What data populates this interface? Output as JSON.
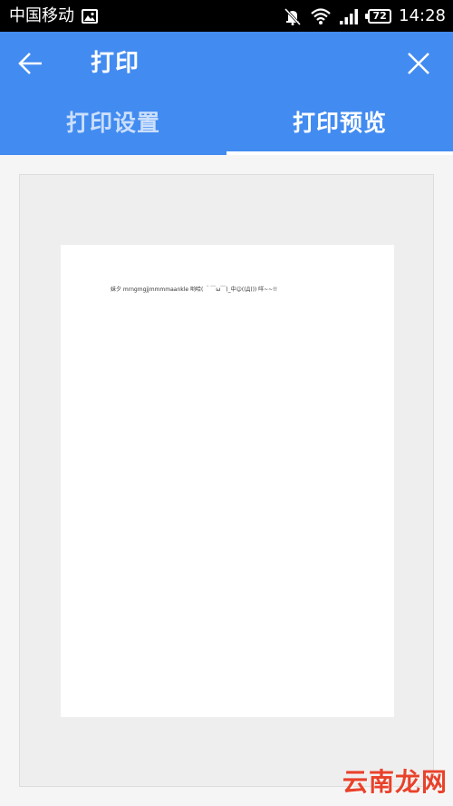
{
  "status_bar": {
    "carrier": "中国移动",
    "battery": "72",
    "time": "14:28"
  },
  "app_bar": {
    "title": "打印"
  },
  "tabs": [
    {
      "label": "打印设置",
      "active": false
    },
    {
      "label": "打印预览",
      "active": true
    }
  ],
  "preview": {
    "page_text": "妹夕 mrngmgjjmmmmaankle 哟哈( ＾￣ω￣)_中☺((Д))) 咩~~!!"
  },
  "watermark": "云南龙网",
  "colors": {
    "accent": "#428bf1",
    "status_bar": "#000000",
    "background": "#f5f5f5",
    "watermark": "#e8422b"
  },
  "icons": {
    "back": "arrow-left-icon",
    "close": "close-icon",
    "gallery": "gallery-icon",
    "mute": "mute-icon",
    "wifi": "wifi-icon",
    "signal": "signal-icon",
    "battery": "battery-icon"
  }
}
